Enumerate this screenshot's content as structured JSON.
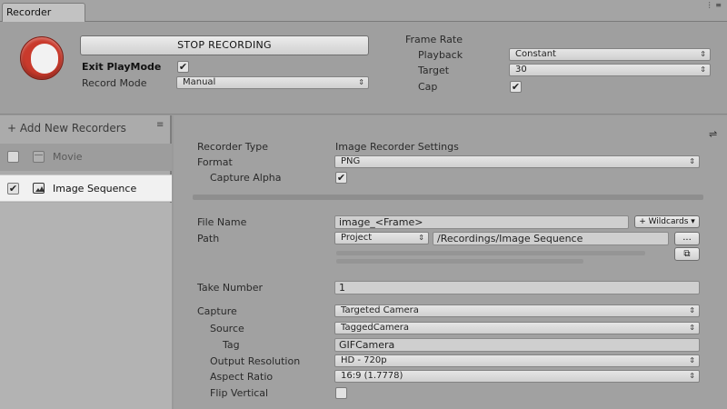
{
  "window": {
    "tab_title": "Recorder",
    "controls": "⋮ ≡"
  },
  "top": {
    "stop_button": "STOP RECORDING",
    "exit_playmode_label": "Exit PlayMode",
    "exit_playmode_checked": true,
    "record_mode_label": "Record Mode",
    "record_mode_value": "Manual",
    "frame_rate_label": "Frame Rate",
    "playback_label": "Playback",
    "playback_value": "Constant",
    "target_label": "Target",
    "target_value": "30",
    "cap_label": "Cap",
    "cap_checked": true
  },
  "left": {
    "add_new_label": "+ Add New Recorders",
    "add_new_menu_icon": "≡",
    "recorders": [
      {
        "name": "Movie",
        "enabled": false,
        "icon": "movie-icon",
        "selected": false
      },
      {
        "name": "Image Sequence",
        "enabled": true,
        "icon": "image-icon",
        "selected": true
      }
    ]
  },
  "settings": {
    "panel_icon": "sliders-icon",
    "recorder_type_label": "Recorder Type",
    "recorder_type_value": "Image Recorder Settings",
    "format_label": "Format",
    "format_value": "PNG",
    "capture_alpha_label": "Capture Alpha",
    "capture_alpha_checked": true,
    "file_name_label": "File Name",
    "file_name_value": "image_<Frame>",
    "wildcards_label": "+ Wildcards ▾",
    "path_label": "Path",
    "path_root_value": "Project",
    "path_value": "/Recordings/Image Sequence",
    "browse_label": "...",
    "open_folder_icon": "open-external-icon",
    "take_number_label": "Take Number",
    "take_number_value": "1",
    "capture_label": "Capture",
    "capture_value": "Targeted Camera",
    "source_label": "Source",
    "source_value": "TaggedCamera",
    "tag_label": "Tag",
    "tag_value": "GIFCamera",
    "output_resolution_label": "Output Resolution",
    "output_resolution_value": "HD - 720p",
    "aspect_ratio_label": "Aspect Ratio",
    "aspect_ratio_value": "16:9 (1.7778)",
    "flip_vertical_label": "Flip Vertical",
    "flip_vertical_checked": false
  },
  "colors": {
    "record_red": "#c93a2c",
    "selected_row": "#f1f1f1",
    "panel_bg": "#a1a1a1"
  }
}
